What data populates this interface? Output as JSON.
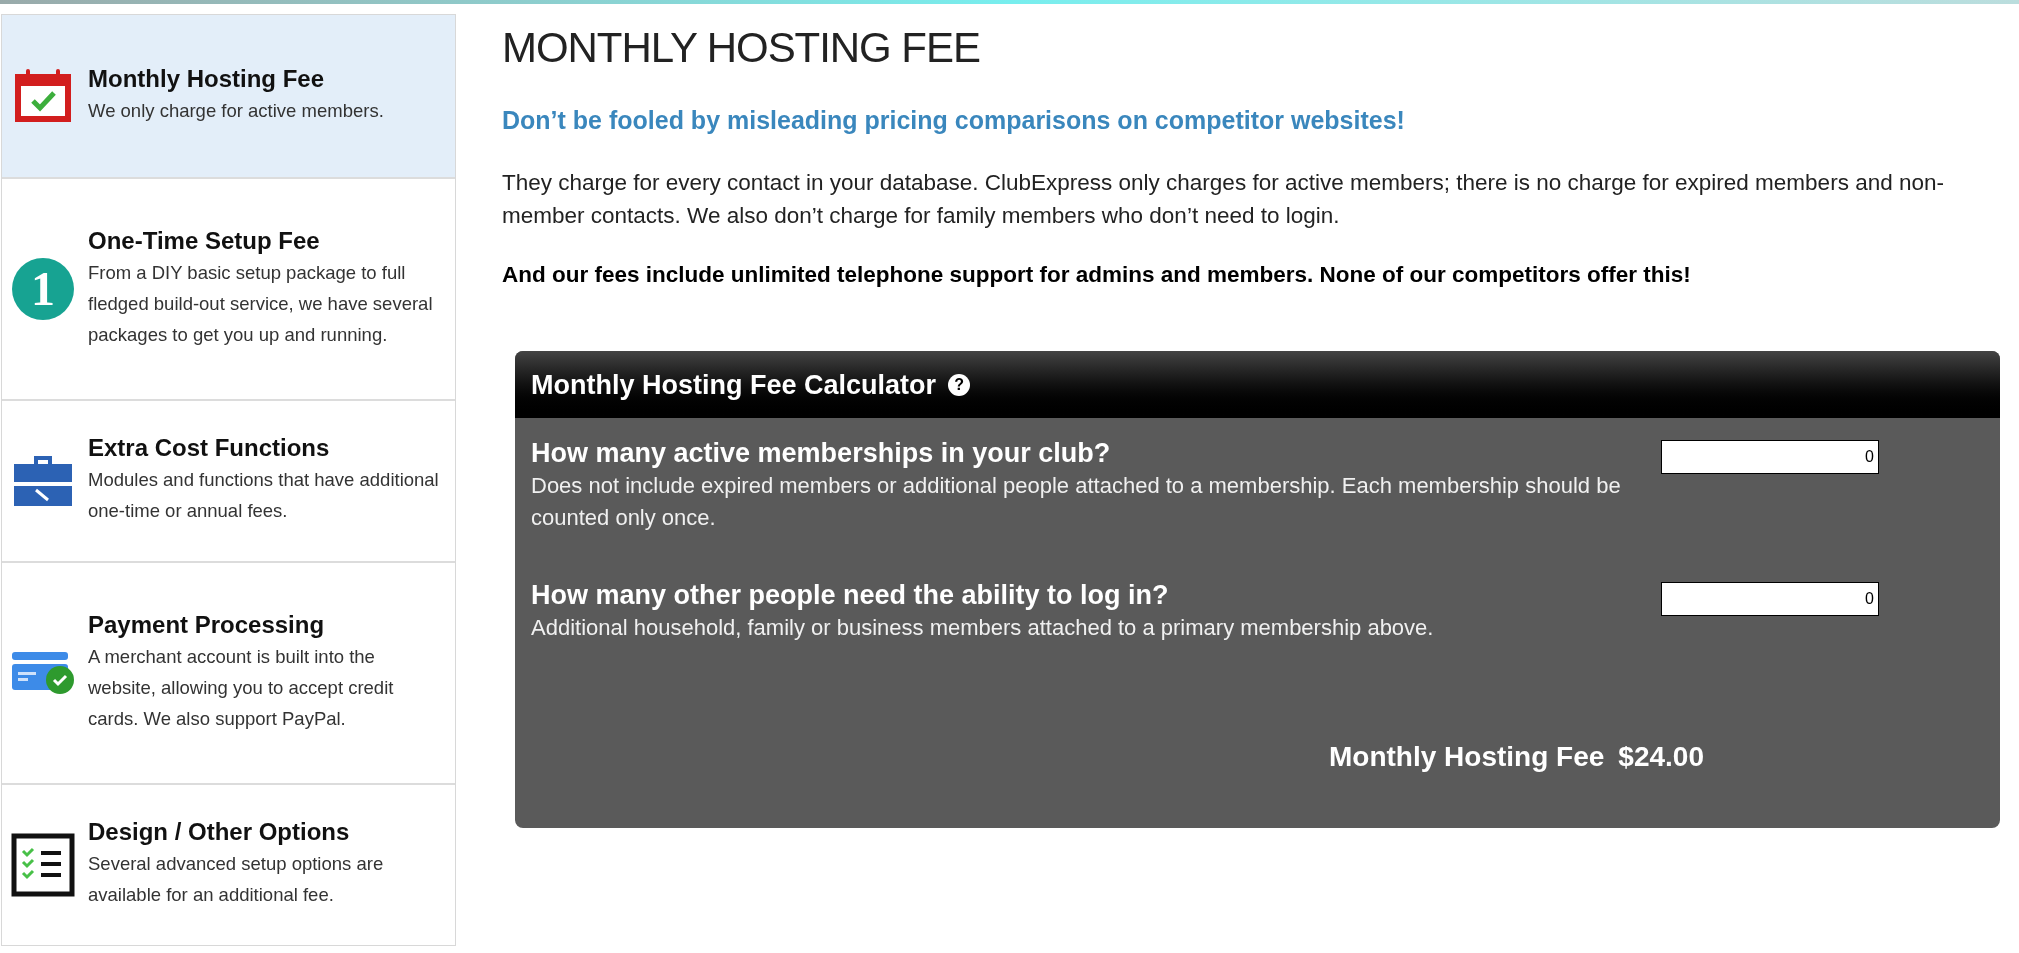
{
  "sidebar": {
    "items": [
      {
        "title": "Monthly Hosting Fee",
        "description": "We only charge for active members.",
        "selected": true
      },
      {
        "title": "One-Time Setup Fee",
        "description": "From a DIY basic setup package to full fledged build-out service, we have several packages to get you up and running.",
        "badge": "1",
        "selected": false
      },
      {
        "title": "Extra Cost Functions",
        "description": "Modules and functions that have additional one-time or annual fees.",
        "selected": false
      },
      {
        "title": "Payment Processing",
        "description": "A merchant account is built into the website, allowing you to accept credit cards. We also support PayPal.",
        "selected": false
      },
      {
        "title": "Design / Other Options",
        "description": "Several advanced setup options are available for an additional fee.",
        "selected": false
      }
    ]
  },
  "main": {
    "heading": "MONTHLY HOSTING FEE",
    "tagline": "Don’t be fooled by misleading pricing comparisons on competitor websites!",
    "paragraph": "They charge for every contact in your database. ClubExpress only charges for active members; there is no charge for expired members and non-member contacts. We also don’t charge for family members who don’t need to login.",
    "emphasis": "And our fees include unlimited telephone support for admins and members. None of our competitors offer this!"
  },
  "calculator": {
    "title": "Monthly Hosting Fee Calculator",
    "help": "?",
    "questions": [
      {
        "question": "How many active memberships in your club?",
        "hint": "Does not include expired members or additional people attached to a membership. Each membership should be counted only once.",
        "value": "0"
      },
      {
        "question": "How many other people need the ability to log in?",
        "hint": "Additional household, family or business members attached to a primary membership above.",
        "value": "0"
      }
    ],
    "total_label": "Monthly Hosting Fee",
    "total": "$24.00"
  }
}
